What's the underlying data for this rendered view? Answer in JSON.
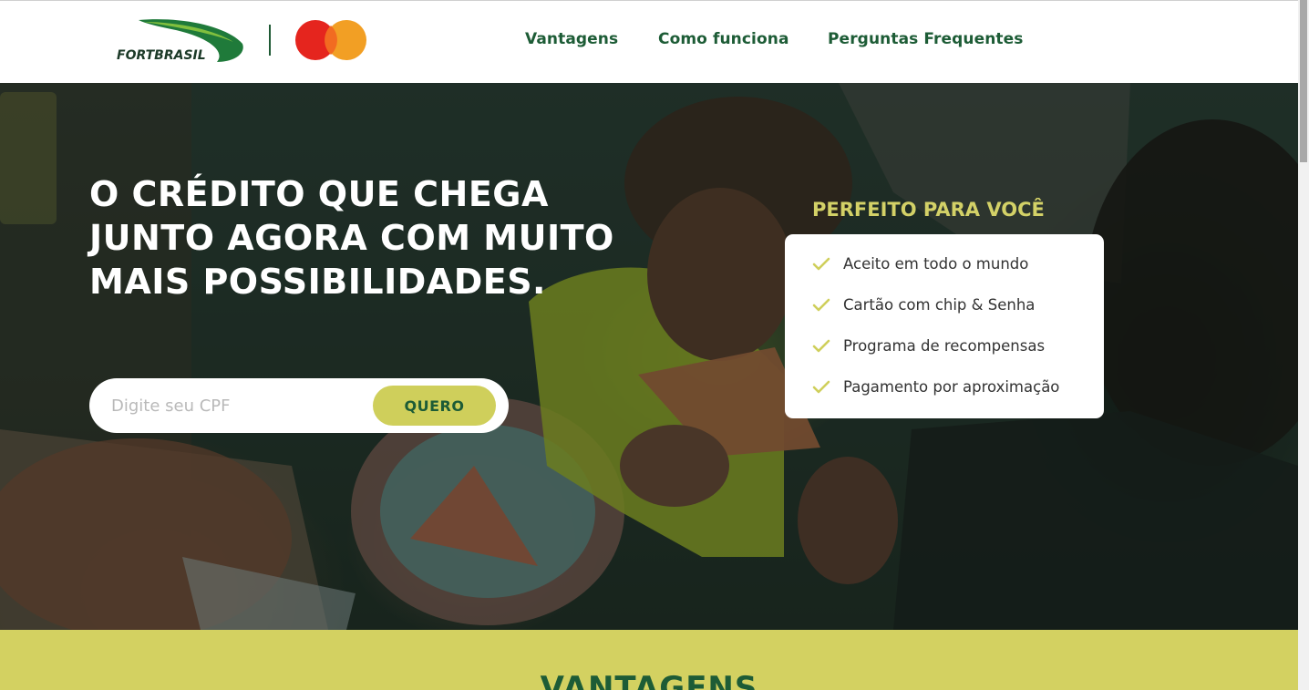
{
  "header": {
    "brand": "FORTBRASIL",
    "partner_logo": "mastercard-logo",
    "nav": [
      {
        "label": "Vantagens"
      },
      {
        "label": "Como funciona"
      },
      {
        "label": "Perguntas Frequentes"
      }
    ]
  },
  "hero": {
    "title_lines": [
      "O CRÉDITO QUE CHEGA",
      "JUNTO AGORA COM MUITO",
      "MAIS POSSIBILIDADES."
    ],
    "cpf_placeholder": "Digite seu CPF",
    "cta_label": "QUERO",
    "benefits_title": "PERFEITO PARA VOCÊ",
    "benefits": [
      {
        "icon": "check-icon",
        "label": "Aceito em todo o mundo"
      },
      {
        "icon": "check-icon",
        "label": "Cartão com chip & Senha"
      },
      {
        "icon": "check-icon",
        "label": "Programa de recompensas"
      },
      {
        "icon": "check-icon",
        "label": "Pagamento por aproximação"
      }
    ]
  },
  "advantages": {
    "title": "VANTAGENS"
  },
  "colors": {
    "brand_green": "#1d5c36",
    "accent_lime": "#d3d161",
    "button_lime": "#cfcf5b",
    "mastercard_red": "#eb001b",
    "mastercard_orange": "#f79e1b"
  }
}
